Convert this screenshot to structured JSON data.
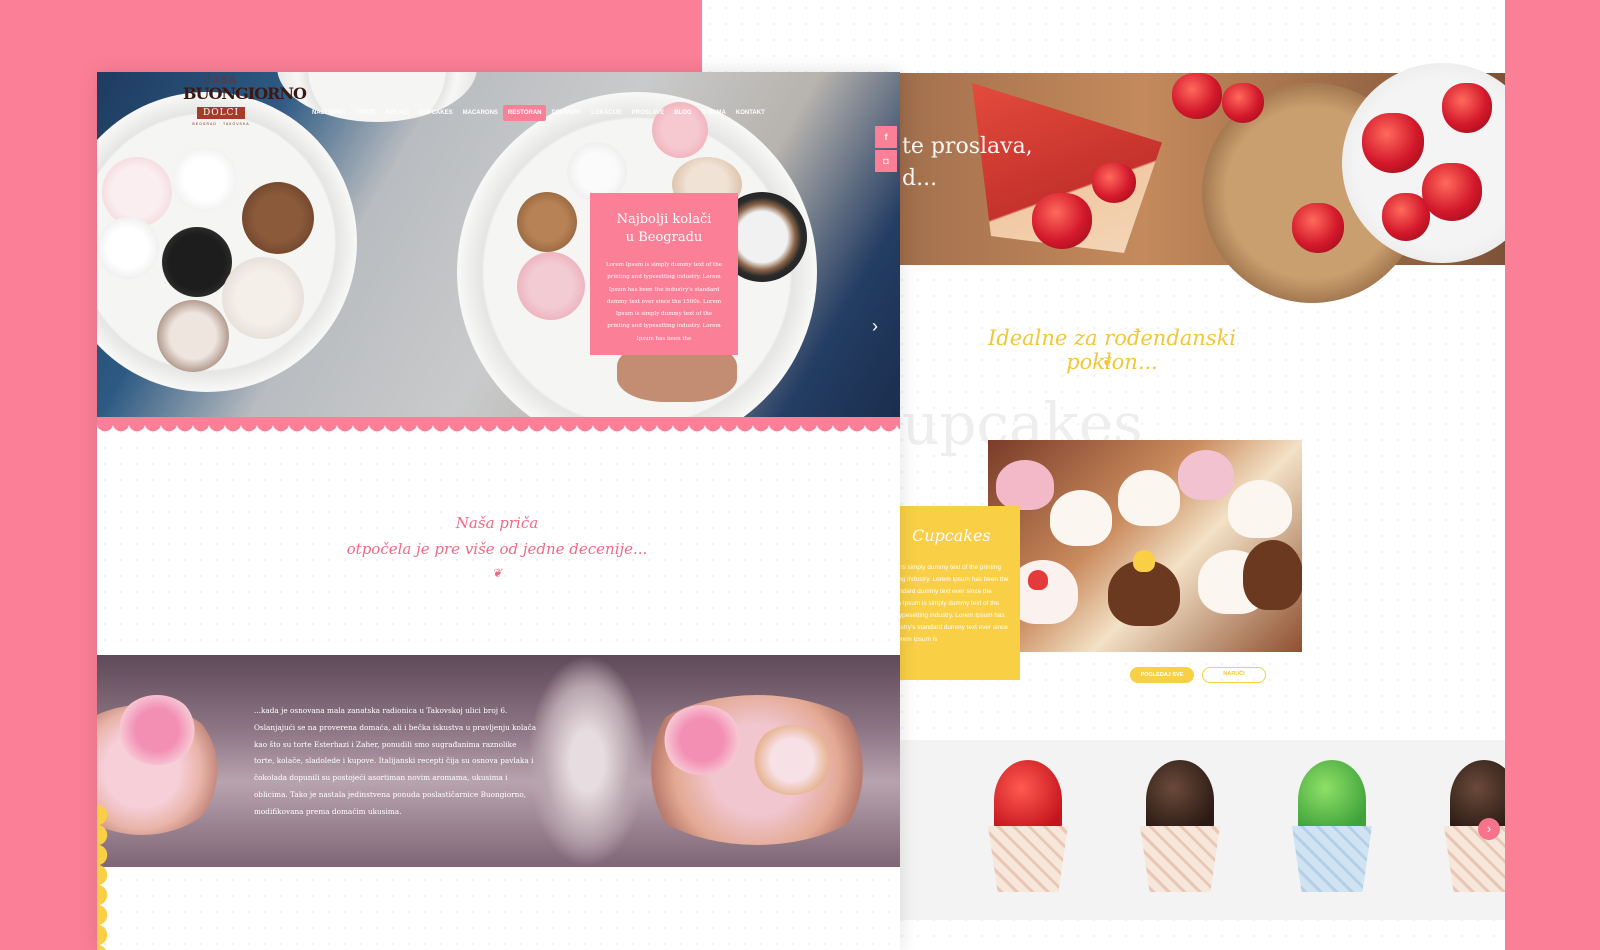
{
  "brand": {
    "logo_top": "CASA",
    "logo_name": "BUONGIORNO",
    "logo_bottom": "DOLCI",
    "logo_small": "BEOGRAD · TAKOVSKA"
  },
  "nav": {
    "items": [
      "NASLOVNA",
      "TORTE",
      "KOLAČI",
      "CUPCAKES",
      "MACARONS",
      "RESTORAN",
      "DELIVERY",
      "LOKACIJE",
      "PROSLAVE",
      "BLOG",
      "O NAMA",
      "KONTAKT"
    ],
    "active": "RESTORAN"
  },
  "social": {
    "facebook": "f",
    "instagram": "◘"
  },
  "hero": {
    "title_line1": "Najbolji kolači",
    "title_line2": "u Beogradu",
    "body": "Lorem Ipsum is simply dummy text of the printing and typesetting industry. Lorem Ipsum has been the industry's standard dummy text ever since the 1500s. Lorem Ipsum is simply dummy text of the printing and typesetting industry. Lorem Ipsum has been the",
    "arrow": "›"
  },
  "story": {
    "line1": "Naša priča",
    "line2": "otpočela je pre više od jedne decenije...",
    "ornament": "❦",
    "body": "...kada je osnovana mala zanatska radionica u Takovskoj ulici broj 6. Oslanjajući se na proverena domaća, ali i bečka iskustva u pravljenju kolača kao što su torte Esterhazi i Zaher, ponudili smo sugrađanima raznolike torte, kolače, sladolede i kupove. Italijanski recepti čija su osnova pavlaka i čokolada dopunili su postojeći asortiman novim aromama, ukusima i oblicima. Tako je nastala jedinstvena ponuda poslastičarnice Buongiorno, modifikovana prema domaćim ukusima."
  },
  "back_page": {
    "hero_text_line1": "te proslava,",
    "hero_text_line2": "d...",
    "heading": "Idealne za rođendanski poklon...",
    "ornament": "❦",
    "ghost_word": "upcakes",
    "card_title": "Cupcakes",
    "card_body": "Lorem Ipsum is simply dummy text of the printing and typesetting industry. Lorem Ipsum has been the industry's standard dummy text ever since the 1500s. Lorem Ipsum is simply dummy text of the printing and typesetting industry. Lorem Ipsum has been the industry's standard dummy text ever since the 1500s. Lorem Ipsum is",
    "btn_primary": "POGLEDAJ SVE",
    "btn_secondary": "NARUČI",
    "carousel_arrow": "›"
  },
  "colors": {
    "pink": "#fb7f97",
    "yellow": "#f8cf45",
    "white": "#ffffff"
  }
}
